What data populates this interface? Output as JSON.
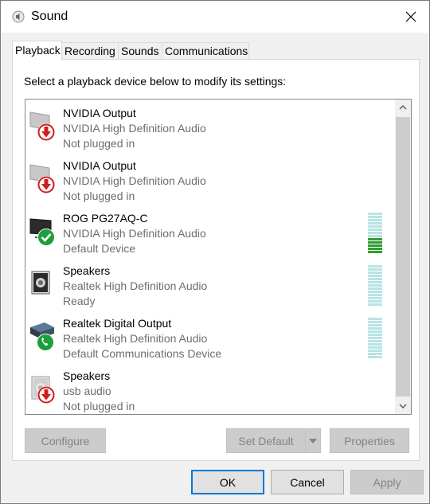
{
  "window": {
    "title": "Sound",
    "icon": "speaker-icon"
  },
  "tabs": [
    {
      "label": "Playback",
      "active": true
    },
    {
      "label": "Recording",
      "active": false
    },
    {
      "label": "Sounds",
      "active": false
    },
    {
      "label": "Communications",
      "active": false
    }
  ],
  "instruction": "Select a playback device below to modify its settings:",
  "devices": [
    {
      "name": "NVIDIA Output",
      "driver": "NVIDIA High Definition Audio",
      "status": "Not plugged in",
      "icon": "monitor-icon",
      "badge": "not-plugged-in-icon",
      "badge_color": "#d21c1c"
    },
    {
      "name": "NVIDIA Output",
      "driver": "NVIDIA High Definition Audio",
      "status": "Not plugged in",
      "icon": "monitor-icon",
      "badge": "not-plugged-in-icon",
      "badge_color": "#d21c1c"
    },
    {
      "name": "ROG PG27AQ-C",
      "driver": "NVIDIA High Definition Audio",
      "status": "Default Device",
      "icon": "monitor-icon",
      "badge": "default-check-icon",
      "badge_color": "#1e9e3a",
      "meter": "active"
    },
    {
      "name": "Speakers",
      "driver": "Realtek High Definition Audio",
      "status": "Ready",
      "icon": "speaker-icon",
      "meter": "idle"
    },
    {
      "name": "Realtek Digital Output",
      "driver": "Realtek High Definition Audio",
      "status": "Default Communications Device",
      "icon": "digital-output-icon",
      "badge": "phone-icon",
      "badge_color": "#1e9e3a",
      "meter": "idle"
    },
    {
      "name": "Speakers",
      "driver": "usb audio",
      "status": "Not plugged in",
      "icon": "speaker-icon",
      "badge": "not-plugged-in-icon",
      "badge_color": "#d21c1c"
    }
  ],
  "buttons": {
    "configure": "Configure",
    "set_default": "Set Default",
    "properties": "Properties",
    "ok": "OK",
    "cancel": "Cancel",
    "apply": "Apply"
  },
  "colors": {
    "accent": "#0078d7",
    "meter_active": "#2f9e2f",
    "meter_idle": "#b9e4e4"
  }
}
